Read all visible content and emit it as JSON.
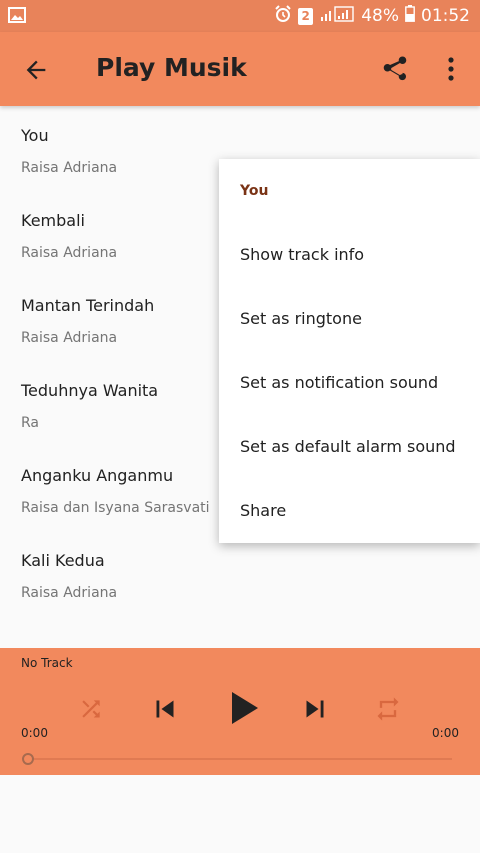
{
  "status_bar": {
    "notification_badge": "2",
    "battery": "48%",
    "time": "01:52",
    "icons": [
      "image-icon",
      "alarm-icon",
      "signal-icon",
      "battery-icon"
    ]
  },
  "app_bar": {
    "title": "Play Musik",
    "icons": [
      "arrow-back-icon",
      "share-icon",
      "more-vert-icon"
    ]
  },
  "tracks": [
    {
      "title": "You",
      "artist": "Raisa Adriana"
    },
    {
      "title": "Kembali",
      "artist": "Raisa Adriana"
    },
    {
      "title": "Mantan Terindah",
      "artist": "Raisa Adriana"
    },
    {
      "title": "Teduhnya Wanita",
      "artist": "Ra"
    },
    {
      "title": "Anganku Anganmu",
      "artist": "Raisa dan Isyana Sarasvati"
    },
    {
      "title": "Kali Kedua",
      "artist": "Raisa Adriana"
    }
  ],
  "player": {
    "now_playing": "No Track",
    "elapsed": "0:00",
    "duration": "0:00",
    "progress": 0,
    "controls": [
      "shuffle-icon",
      "skip-previous-icon",
      "play-icon",
      "skip-next-icon",
      "repeat-icon"
    ]
  },
  "menu": {
    "header": "You",
    "items": [
      "Show track info",
      "Set as ringtone",
      "Set as notification sound",
      "Set as default alarm sound",
      "Share"
    ]
  },
  "colors": {
    "status_bar": "#e8835a",
    "app_bar": "#f2895d",
    "player": "#f2895d",
    "menu_header": "#7a3315",
    "disabled_control": "#d9683f"
  }
}
